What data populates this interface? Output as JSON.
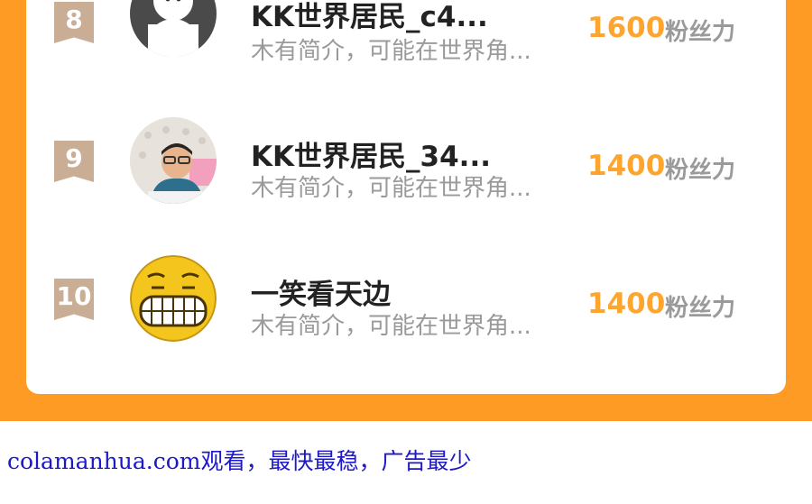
{
  "ranking": {
    "rows": [
      {
        "rank": "8",
        "name": "KK世界居民_c4...",
        "intro": "木有简介，可能在世界角...",
        "score": "1600",
        "unit": "粉丝力",
        "avatar": "ghost-avatar"
      },
      {
        "rank": "9",
        "name": "KK世界居民_34...",
        "intro": "木有简介，可能在世界角...",
        "score": "1400",
        "unit": "粉丝力",
        "avatar": "child-photo-avatar"
      },
      {
        "rank": "10",
        "name": "一笑看天边",
        "intro": "木有简介，可能在世界角...",
        "score": "1400",
        "unit": "粉丝力",
        "avatar": "grin-emoji-avatar"
      }
    ],
    "colors": {
      "accent": "#fd9b25",
      "score": "#fda52e",
      "badge": "#c9ad95"
    }
  },
  "footer": {
    "text": "colamanhua.com观看，最快最稳，广告最少",
    "color": "#1d18c8"
  }
}
